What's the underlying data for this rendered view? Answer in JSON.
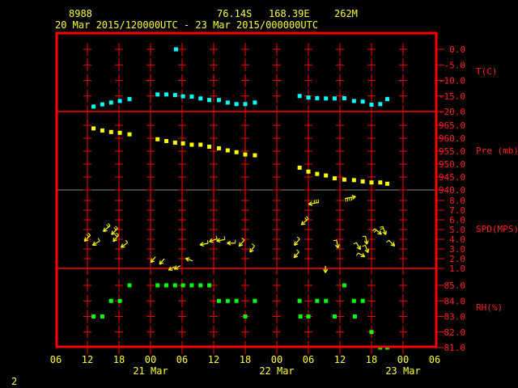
{
  "header": {
    "station": "8988",
    "latitude": "76.14S",
    "longitude": "168.39E",
    "elevation": "262M",
    "period": "20 Mar 2015/120000UTC - 23 Mar 2015/000000UTC"
  },
  "page_number": "2",
  "colors": {
    "background": "#000000",
    "frame": "#ff0000",
    "text": "#ffff33",
    "temperature": "#00ffff",
    "pressure": "#ffff00",
    "wind": "#ffff00",
    "humidity": "#00ff00"
  },
  "chart_data": {
    "type": "scatter",
    "xlim": [
      "2015-03-20T06:00Z",
      "2015-03-23T06:00Z"
    ],
    "x_ticks": [
      {
        "time": "2015-03-20T06:00Z",
        "label": "06"
      },
      {
        "time": "2015-03-20T12:00Z",
        "label": "12"
      },
      {
        "time": "2015-03-20T18:00Z",
        "label": "18"
      },
      {
        "time": "2015-03-21T00:00Z",
        "label": "00"
      },
      {
        "time": "2015-03-21T06:00Z",
        "label": "06"
      },
      {
        "time": "2015-03-21T12:00Z",
        "label": "12"
      },
      {
        "time": "2015-03-21T18:00Z",
        "label": "18"
      },
      {
        "time": "2015-03-22T00:00Z",
        "label": "00"
      },
      {
        "time": "2015-03-22T06:00Z",
        "label": "06"
      },
      {
        "time": "2015-03-22T12:00Z",
        "label": "12"
      },
      {
        "time": "2015-03-22T18:00Z",
        "label": "18"
      },
      {
        "time": "2015-03-23T00:00Z",
        "label": "00"
      },
      {
        "time": "2015-03-23T06:00Z",
        "label": "06"
      }
    ],
    "day_labels": [
      {
        "time": "2015-03-21T00:00Z",
        "label": "21 Mar"
      },
      {
        "time": "2015-03-22T00:00Z",
        "label": "22 Mar"
      },
      {
        "time": "2015-03-23T00:00Z",
        "label": "23 Mar"
      }
    ],
    "times": [
      "2015-03-20T13:10Z",
      "2015-03-20T14:50Z",
      "2015-03-20T16:30Z",
      "2015-03-20T18:10Z",
      "2015-03-20T20:00Z",
      "2015-03-21T01:20Z",
      "2015-03-21T03:00Z",
      "2015-03-21T04:40Z",
      "2015-03-21T06:10Z",
      "2015-03-21T07:50Z",
      "2015-03-21T09:30Z",
      "2015-03-21T11:10Z",
      "2015-03-21T13:00Z",
      "2015-03-21T14:40Z",
      "2015-03-21T16:20Z",
      "2015-03-21T18:00Z",
      "2015-03-21T19:50Z",
      "2015-03-22T04:20Z",
      "2015-03-22T06:00Z",
      "2015-03-22T07:40Z",
      "2015-03-22T09:20Z",
      "2015-03-22T11:00Z",
      "2015-03-22T12:50Z",
      "2015-03-22T14:40Z",
      "2015-03-22T16:20Z",
      "2015-03-22T18:00Z",
      "2015-03-22T19:40Z",
      "2015-03-22T21:00Z"
    ],
    "panels": [
      {
        "id": "temperature",
        "ylabel": "T(C)",
        "ylim": [
          -20,
          0
        ],
        "ticks": [
          {
            "v": 0,
            "label": "0.0"
          },
          {
            "v": -5,
            "label": "-5.0"
          },
          {
            "v": -10,
            "label": "-10.0"
          },
          {
            "v": -15,
            "label": "-15.0"
          },
          {
            "v": -20,
            "label": "-20.0"
          }
        ],
        "values": [
          -18.4,
          -17.7,
          -17.1,
          -16.6,
          -16.0,
          -14.5,
          -14.5,
          -14.7,
          -15.1,
          -15.2,
          -15.8,
          -16.3,
          -16.3,
          -17.1,
          -17.6,
          -17.6,
          -17.1,
          -15.0,
          -15.5,
          -15.7,
          -15.8,
          -15.8,
          -15.7,
          -16.6,
          -16.8,
          -17.8,
          -17.6,
          -16.0
        ],
        "extra_points": [
          {
            "time": "2015-03-21T04:50Z",
            "value": 0.0
          }
        ]
      },
      {
        "id": "pressure",
        "ylabel": "Pre (mb)",
        "ylim": [
          940,
          965
        ],
        "ticks": [
          {
            "v": 965,
            "label": "965.0"
          },
          {
            "v": 960,
            "label": "960.0"
          },
          {
            "v": 955,
            "label": "955.0"
          },
          {
            "v": 950,
            "label": "950.0"
          },
          {
            "v": 945,
            "label": "945.0"
          },
          {
            "v": 940,
            "label": "940.0"
          }
        ],
        "values": [
          963.8,
          963.0,
          962.4,
          962.1,
          961.5,
          959.6,
          958.9,
          958.3,
          958.0,
          957.5,
          957.5,
          956.7,
          956.1,
          955.3,
          954.6,
          953.7,
          953.4,
          948.6,
          947.1,
          946.2,
          945.6,
          944.5,
          944.0,
          943.8,
          943.3,
          942.9,
          942.9,
          942.4
        ],
        "extra_points": []
      },
      {
        "id": "wind",
        "ylabel": "SPD(MPS)",
        "ylim": [
          1,
          8
        ],
        "ticks": [
          {
            "v": 8,
            "label": "8.0"
          },
          {
            "v": 7,
            "label": "7.0"
          },
          {
            "v": 6,
            "label": "6.0"
          },
          {
            "v": 5,
            "label": "5.0"
          },
          {
            "v": 4,
            "label": "4.0"
          },
          {
            "v": 3,
            "label": "3.0"
          },
          {
            "v": 2,
            "label": "2.0"
          },
          {
            "v": 1,
            "label": "1.0"
          }
        ],
        "wind": [
          {
            "time": "2015-03-20T12:00Z",
            "speed": 4.1,
            "direction": 45
          },
          {
            "time": "2015-03-20T13:40Z",
            "speed": 3.6,
            "direction": 60
          },
          {
            "time": "2015-03-20T15:40Z",
            "speed": 5.1,
            "direction": 50
          },
          {
            "time": "2015-03-20T17:10Z",
            "speed": 4.8,
            "direction": 45
          },
          {
            "time": "2015-03-20T17:25Z",
            "speed": 4.1,
            "direction": 40
          },
          {
            "time": "2015-03-20T19:00Z",
            "speed": 3.4,
            "direction": 55
          },
          {
            "time": "2015-03-21T00:30Z",
            "speed": 1.9,
            "direction": 40
          },
          {
            "time": "2015-03-21T02:10Z",
            "speed": 1.7,
            "direction": 40
          },
          {
            "time": "2015-03-21T04:00Z",
            "speed": 1.0,
            "direction": 60
          },
          {
            "time": "2015-03-21T05:05Z",
            "speed": 1.1,
            "direction": 60
          },
          {
            "time": "2015-03-21T07:20Z",
            "speed": 1.9,
            "direction": 110
          },
          {
            "time": "2015-03-21T10:10Z",
            "speed": 3.5,
            "direction": 80
          },
          {
            "time": "2015-03-21T11:55Z",
            "speed": 3.9,
            "direction": 70
          },
          {
            "time": "2015-03-21T13:20Z",
            "speed": 3.9,
            "direction": 80
          },
          {
            "time": "2015-03-21T15:20Z",
            "speed": 3.6,
            "direction": 90
          },
          {
            "time": "2015-03-21T17:20Z",
            "speed": 3.6,
            "direction": 40
          },
          {
            "time": "2015-03-21T19:20Z",
            "speed": 3.0,
            "direction": 35
          },
          {
            "time": "2015-03-22T03:45Z",
            "speed": 2.4,
            "direction": 40
          },
          {
            "time": "2015-03-22T03:50Z",
            "speed": 3.7,
            "direction": 40
          },
          {
            "time": "2015-03-22T05:20Z",
            "speed": 5.8,
            "direction": 50
          },
          {
            "time": "2015-03-22T07:00Z",
            "speed": 7.7,
            "direction": 80
          },
          {
            "time": "2015-03-22T09:15Z",
            "speed": 0.9,
            "direction": 0
          },
          {
            "time": "2015-03-22T11:30Z",
            "speed": 3.5,
            "direction": 350
          },
          {
            "time": "2015-03-22T14:00Z",
            "speed": 8.3,
            "direction": 260
          },
          {
            "time": "2015-03-22T15:30Z",
            "speed": 3.3,
            "direction": 330
          },
          {
            "time": "2015-03-22T16:05Z",
            "speed": 2.4,
            "direction": 300
          },
          {
            "time": "2015-03-22T17:00Z",
            "speed": 3.9,
            "direction": 350
          },
          {
            "time": "2015-03-22T17:05Z",
            "speed": 3.0,
            "direction": 340
          },
          {
            "time": "2015-03-22T19:15Z",
            "speed": 4.8,
            "direction": 310
          },
          {
            "time": "2015-03-22T20:25Z",
            "speed": 4.9,
            "direction": 340
          },
          {
            "time": "2015-03-22T21:50Z",
            "speed": 3.6,
            "direction": 315
          }
        ]
      },
      {
        "id": "humidity",
        "ylabel": "RH(%)",
        "ylim": [
          81,
          85
        ],
        "ticks": [
          {
            "v": 85,
            "label": "85.0"
          },
          {
            "v": 84,
            "label": "84.0"
          },
          {
            "v": 83,
            "label": "83.0"
          },
          {
            "v": 82,
            "label": "82.0"
          },
          {
            "v": 81,
            "label": "81.0"
          }
        ],
        "values": [
          83,
          83,
          84,
          84,
          85,
          85,
          85,
          85,
          85,
          85,
          85,
          85,
          84,
          84,
          84,
          83,
          84,
          84,
          83,
          84,
          84,
          83,
          85,
          84,
          84,
          82,
          81,
          81
        ],
        "extra_points": [
          {
            "time": "2015-03-22T04:30Z",
            "value": 83
          },
          {
            "time": "2015-03-22T14:50Z",
            "value": 83
          }
        ]
      }
    ]
  }
}
